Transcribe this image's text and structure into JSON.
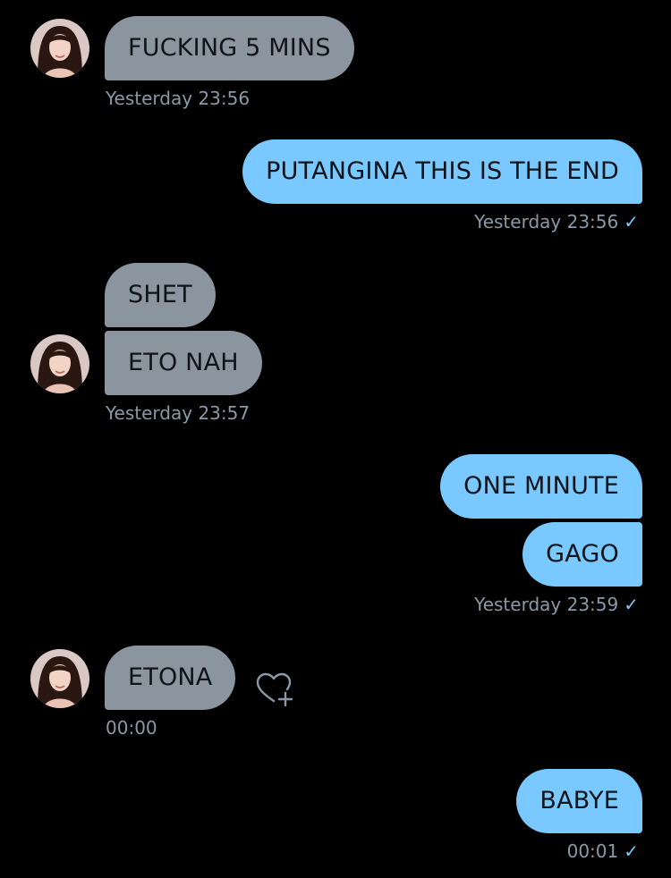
{
  "conversation": {
    "messages": [
      {
        "id": 1,
        "side": "in",
        "text": "FUCKING 5 MINS"
      },
      {
        "id": 2,
        "side": "out",
        "text": "PUTANGINA THIS IS THE END"
      },
      {
        "id": 3,
        "side": "in",
        "text": "SHET"
      },
      {
        "id": 4,
        "side": "in",
        "text": "ETO NAH"
      },
      {
        "id": 5,
        "side": "out",
        "text": "ONE MINUTE"
      },
      {
        "id": 6,
        "side": "out",
        "text": "GAGO"
      },
      {
        "id": 7,
        "side": "in",
        "text": "ETONA"
      },
      {
        "id": 8,
        "side": "out",
        "text": "BABYE"
      }
    ],
    "timestamps": {
      "t1": "Yesterday 23:56",
      "t2": "Yesterday 23:56",
      "t3": "Yesterday 23:57",
      "t4": "Yesterday 23:59",
      "t5": "00:00",
      "t6": "00:01"
    },
    "read_mark": "✓",
    "colors": {
      "incoming_bubble": "#8a95a0",
      "outgoing_bubble": "#79c8ff",
      "timestamp": "#8b98a5",
      "background": "#000000"
    },
    "icons": {
      "avatar": "contact-avatar",
      "reaction": "heart-plus-icon",
      "read": "checkmark-icon"
    }
  }
}
